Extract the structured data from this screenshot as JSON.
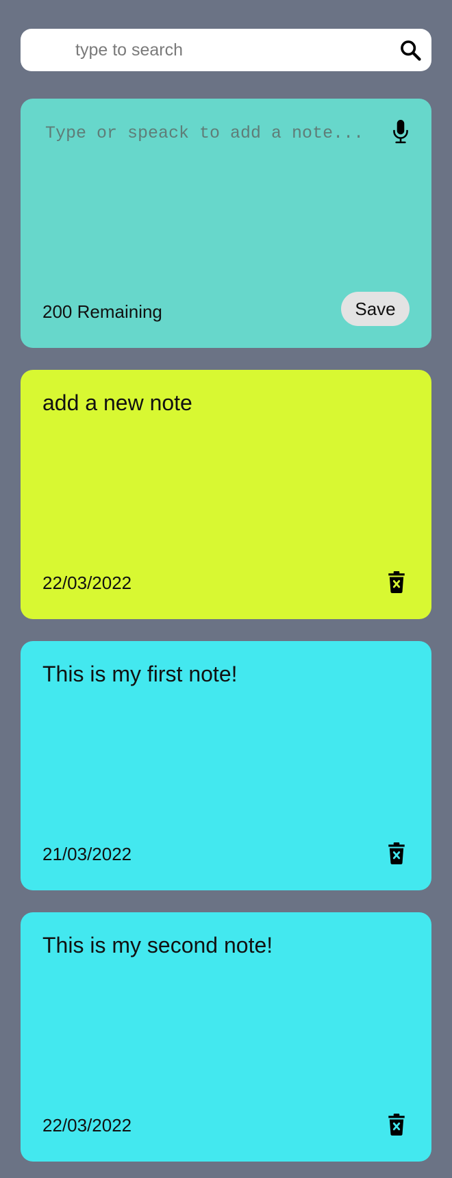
{
  "search": {
    "placeholder": "type to search",
    "value": ""
  },
  "new_note": {
    "placeholder": "Type or speack to add a note...",
    "value": "",
    "remaining_label": "200 Remaining",
    "save_label": "Save",
    "color": "#67d7cb"
  },
  "notes": [
    {
      "text": "add a new note",
      "date": "22/03/2022",
      "color": "#d8f832"
    },
    {
      "text": "This is my first note!",
      "date": "21/03/2022",
      "color": "#43e8ef"
    },
    {
      "text": "This is my second note!",
      "date": "22/03/2022",
      "color": "#43e8ef"
    }
  ],
  "icons": {
    "search": "search-icon",
    "mic": "microphone-icon",
    "delete": "trash-icon"
  },
  "colors": {
    "background": "#6b7385",
    "search_bg": "#ffffff",
    "save_button_bg": "#e3e3e3"
  }
}
